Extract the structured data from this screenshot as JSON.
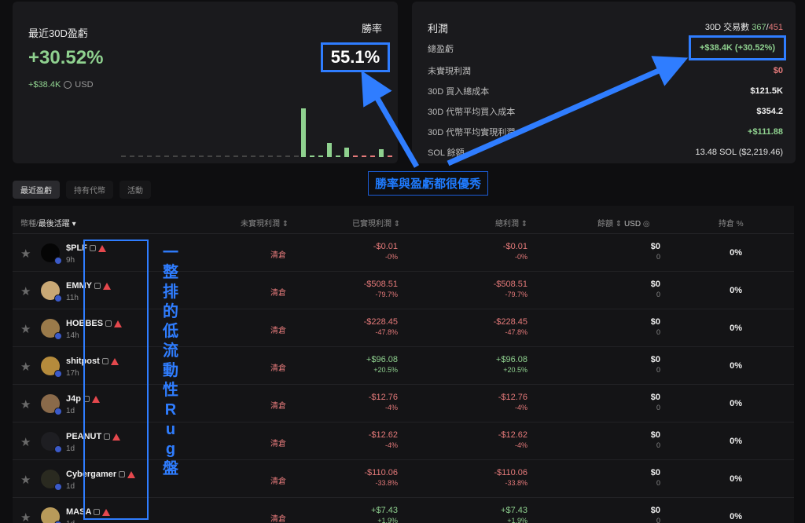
{
  "pnl_card": {
    "title": "最近30D盈虧",
    "percent": "+30.52%",
    "usd_value": "+$38.4K",
    "usd_unit": "USD",
    "winrate_label": "勝率",
    "winrate_value": "55.1%"
  },
  "profit_card": {
    "title": "利潤",
    "trades_label": "30D 交易數",
    "trades_win": "367",
    "trades_sep": "/",
    "trades_total": "451",
    "rows": [
      {
        "label": "總盈虧",
        "value": "+$38.4K (+30.52%)"
      },
      {
        "label": "未實現利潤",
        "value": "$0"
      },
      {
        "label": "30D 買入總成本",
        "value": "$121.5K"
      },
      {
        "label": "30D 代幣平均買入成本",
        "value": "$354.2"
      },
      {
        "label": "30D 代幣平均實現利潤",
        "value": "+$111.88"
      },
      {
        "label": "SOL 餘額",
        "value": "13.48 SOL ($2,219.46)"
      }
    ]
  },
  "tabs": [
    "最近盈虧",
    "持有代幣",
    "活動"
  ],
  "annotations": {
    "good": "勝率與盈虧都很優秀",
    "rug": [
      "一",
      "整",
      "排",
      "的",
      "低",
      "流",
      "動",
      "性",
      "R",
      "u",
      "g",
      "盤"
    ]
  },
  "table": {
    "headers": {
      "token": "幣種/",
      "last_active": "最後活躍",
      "unrealized": "未實現利潤",
      "realized": "已實現利潤",
      "total": "總利潤",
      "balance": "餘額",
      "usd": "USD",
      "holding": "持倉 %"
    },
    "rows": [
      {
        "name": "$PLF",
        "age": "9h",
        "unrealized": "清倉",
        "realized": "-$0.01",
        "realized_pct": "-0%",
        "total": "-$0.01",
        "total_pct": "-0%",
        "balance": "$0",
        "balance_sub": "0",
        "holding": "0%"
      },
      {
        "name": "EMMY",
        "age": "11h",
        "unrealized": "清倉",
        "realized": "-$508.51",
        "realized_pct": "-79.7%",
        "total": "-$508.51",
        "total_pct": "-79.7%",
        "balance": "$0",
        "balance_sub": "0",
        "holding": "0%"
      },
      {
        "name": "HOBBES",
        "age": "14h",
        "unrealized": "清倉",
        "realized": "-$228.45",
        "realized_pct": "-47.8%",
        "total": "-$228.45",
        "total_pct": "-47.8%",
        "balance": "$0",
        "balance_sub": "0",
        "holding": "0%"
      },
      {
        "name": "shitpost",
        "age": "17h",
        "unrealized": "清倉",
        "realized": "+$96.08",
        "realized_pct": "+20.5%",
        "total": "+$96.08",
        "total_pct": "+20.5%",
        "balance": "$0",
        "balance_sub": "0",
        "holding": "0%"
      },
      {
        "name": "J4p",
        "age": "1d",
        "unrealized": "清倉",
        "realized": "-$12.76",
        "realized_pct": "-4%",
        "total": "-$12.76",
        "total_pct": "-4%",
        "balance": "$0",
        "balance_sub": "0",
        "holding": "0%"
      },
      {
        "name": "PEANUT",
        "age": "1d",
        "unrealized": "清倉",
        "realized": "-$12.62",
        "realized_pct": "-4%",
        "total": "-$12.62",
        "total_pct": "-4%",
        "balance": "$0",
        "balance_sub": "0",
        "holding": "0%"
      },
      {
        "name": "Cybergamer",
        "age": "1d",
        "unrealized": "清倉",
        "realized": "-$110.06",
        "realized_pct": "-33.8%",
        "total": "-$110.06",
        "total_pct": "-33.8%",
        "balance": "$0",
        "balance_sub": "0",
        "holding": "0%"
      },
      {
        "name": "MASA",
        "age": "1d",
        "unrealized": "清倉",
        "realized": "+$7.43",
        "realized_pct": "+1.9%",
        "total": "+$7.43",
        "total_pct": "+1.9%",
        "balance": "$0",
        "balance_sub": "0",
        "holding": "0%"
      }
    ]
  },
  "colors": {
    "positive": "#8fd18f",
    "negative": "#e57a7a",
    "annotation": "#2f7dff"
  }
}
